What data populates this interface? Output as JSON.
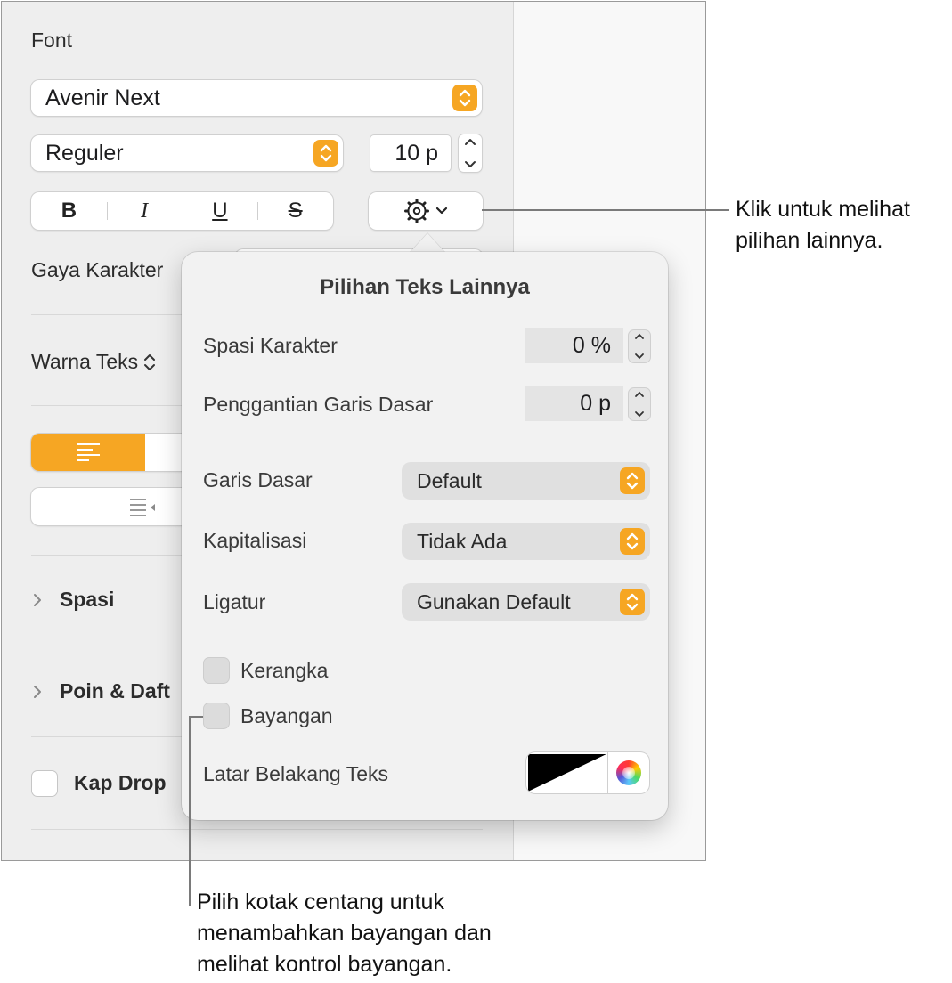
{
  "sidebar": {
    "font_section_label": "Font",
    "font_family": "Avenir Next",
    "font_style": "Reguler",
    "font_size": "10 p",
    "style_buttons": {
      "bold": "B",
      "italic": "I",
      "underline": "U",
      "strikethrough": "S"
    },
    "character_style_label": "Gaya Karakter",
    "text_color_label": "Warna Teks",
    "spacing_label": "Spasi",
    "bullets_label": "Poin & Daft",
    "drop_cap_label": "Kap Drop"
  },
  "popover": {
    "title": "Pilihan Teks Lainnya",
    "character_spacing_label": "Spasi Karakter",
    "character_spacing_value": "0 %",
    "baseline_shift_label": "Penggantian Garis Dasar",
    "baseline_shift_value": "0 p",
    "baseline_label": "Garis Dasar",
    "baseline_value": "Default",
    "capitalization_label": "Kapitalisasi",
    "capitalization_value": "Tidak Ada",
    "ligatures_label": "Ligatur",
    "ligatures_value": "Gunakan Default",
    "outline_label": "Kerangka",
    "shadow_label": "Bayangan",
    "text_background_label": "Latar Belakang Teks"
  },
  "callouts": {
    "gear_line1": "Klik untuk melihat",
    "gear_line2": "pilihan lainnya.",
    "shadow_line1": "Pilih kotak centang untuk",
    "shadow_line2": "menambahkan bayangan dan",
    "shadow_line3": "melihat kontrol bayangan."
  },
  "colors": {
    "accent": "#f6a623",
    "sidebar_bg": "#eeeeee",
    "popover_bg": "#f2f2f2"
  },
  "icons": [
    "chevron-updown-icon",
    "gear-icon",
    "chevron-down-icon",
    "align-left-icon",
    "indent-icon",
    "disclosure-chevron-icon",
    "color-wheel-icon"
  ]
}
